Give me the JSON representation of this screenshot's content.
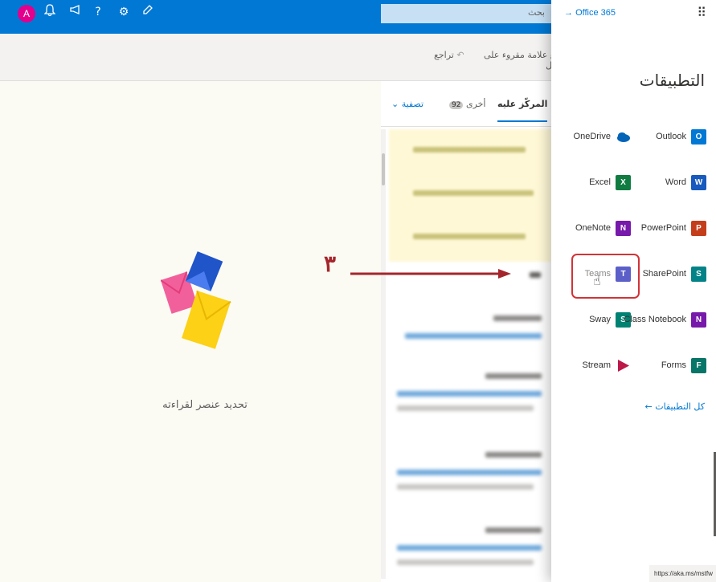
{
  "topbar": {
    "avatar_letter": "A",
    "icons": [
      "bell-icon",
      "megaphone-icon",
      "help-icon",
      "gear-icon",
      "edit-icon"
    ],
    "search_placeholder": "بحث",
    "accent": "#0078d4"
  },
  "commands": {
    "mark_all_read": "ضع علامة مقروء على الكل",
    "undo": "تراجع"
  },
  "mail_list": {
    "tab_focused": "المركّز عليه",
    "tab_other": "أخرى",
    "other_count": "92",
    "filter": "تصفية"
  },
  "reading_pane": {
    "empty_message": "تحديد عنصر لقراءته"
  },
  "annotation": {
    "step_number": "٣",
    "color": "#a4262c"
  },
  "app_launcher": {
    "office_link": "Office 365",
    "title": "التطبيقات",
    "apps": [
      {
        "name": "OneDrive",
        "icon": "onedrive-icon",
        "color": "#0364b8",
        "letter": ""
      },
      {
        "name": "Outlook",
        "icon": "outlook-icon",
        "color": "#0078d4",
        "letter": "O"
      },
      {
        "name": "Excel",
        "icon": "excel-icon",
        "color": "#107c41",
        "letter": "X"
      },
      {
        "name": "Word",
        "icon": "word-icon",
        "color": "#185abd",
        "letter": "W"
      },
      {
        "name": "OneNote",
        "icon": "onenote-icon",
        "color": "#7719aa",
        "letter": "N"
      },
      {
        "name": "PowerPoint",
        "icon": "powerpoint-icon",
        "color": "#c43e1c",
        "letter": "P"
      },
      {
        "name": "Teams",
        "icon": "teams-icon",
        "color": "#5b5fc7",
        "letter": "T"
      },
      {
        "name": "SharePoint",
        "icon": "sharepoint-icon",
        "color": "#038387",
        "letter": "S"
      },
      {
        "name": "Sway",
        "icon": "sway-icon",
        "color": "#008272",
        "letter": "S"
      },
      {
        "name": "Class Notebook",
        "icon": "class-notebook-icon",
        "color": "#7719aa",
        "letter": "N"
      },
      {
        "name": "Stream",
        "icon": "stream-icon",
        "color": "#bc1948",
        "letter": ""
      },
      {
        "name": "Forms",
        "icon": "forms-icon",
        "color": "#077568",
        "letter": "F"
      }
    ],
    "all_apps": "كل التطبيقات",
    "status_url": "https://aka.ms/mstfw"
  }
}
